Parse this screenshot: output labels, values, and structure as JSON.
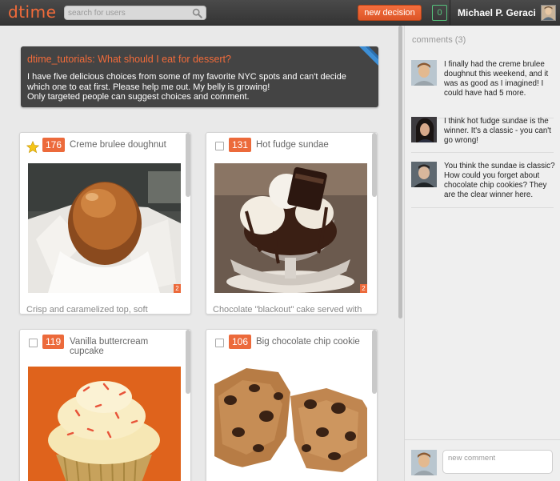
{
  "header": {
    "logo": "dtime",
    "search_placeholder": "search for users",
    "new_decision_label": "new decision",
    "notification_count": "0",
    "user_name": "Michael P. Geraci"
  },
  "decision": {
    "title": "dtime_tutorials: What should I eat for dessert?",
    "description_lines": [
      "I have five delicious choices from some of my favorite NYC spots and can't decide",
      "which one to eat first. Please help me out. My belly is growing!",
      "Only targeted people can suggest choices and comment."
    ]
  },
  "choices": [
    {
      "votes": "176",
      "title": "Creme brulee doughnut",
      "description": "Crisp and caramelized top, soft",
      "photo_count": "2",
      "starred": true,
      "checked": false
    },
    {
      "votes": "131",
      "title": "Hot fudge sundae",
      "description": "Chocolate \"blackout\" cake served with",
      "photo_count": "2",
      "starred": false,
      "checked": false
    },
    {
      "votes": "119",
      "title": "Vanilla buttercream cupcake",
      "description": "",
      "photo_count": "",
      "starred": false,
      "checked": false
    },
    {
      "votes": "106",
      "title": "Big chocolate chip cookie",
      "description": "",
      "photo_count": "",
      "starred": false,
      "checked": false
    }
  ],
  "comments": {
    "heading": "comments (3)",
    "items": [
      {
        "text": "I finally had the creme brulee doughnut this weekend, and it was as good as I imagined! I could have had 5 more."
      },
      {
        "text": "I think hot fudge sundae is the winner. It's a classic - you can't go wrong!"
      },
      {
        "text": "You think the sundae is classic? How could you forget about chocolate chip cookies? They are the clear winner here."
      }
    ],
    "new_comment_placeholder": "new comment"
  },
  "colors": {
    "accent": "#f26b3a",
    "vote_badge": "#ec6a3b",
    "notification": "#56c37c",
    "topbar": "#3c3c3c",
    "decision_bg": "#444444"
  },
  "icons": {
    "search": "search-icon",
    "star": "star-icon",
    "ribbon": "ribbon-icon"
  }
}
